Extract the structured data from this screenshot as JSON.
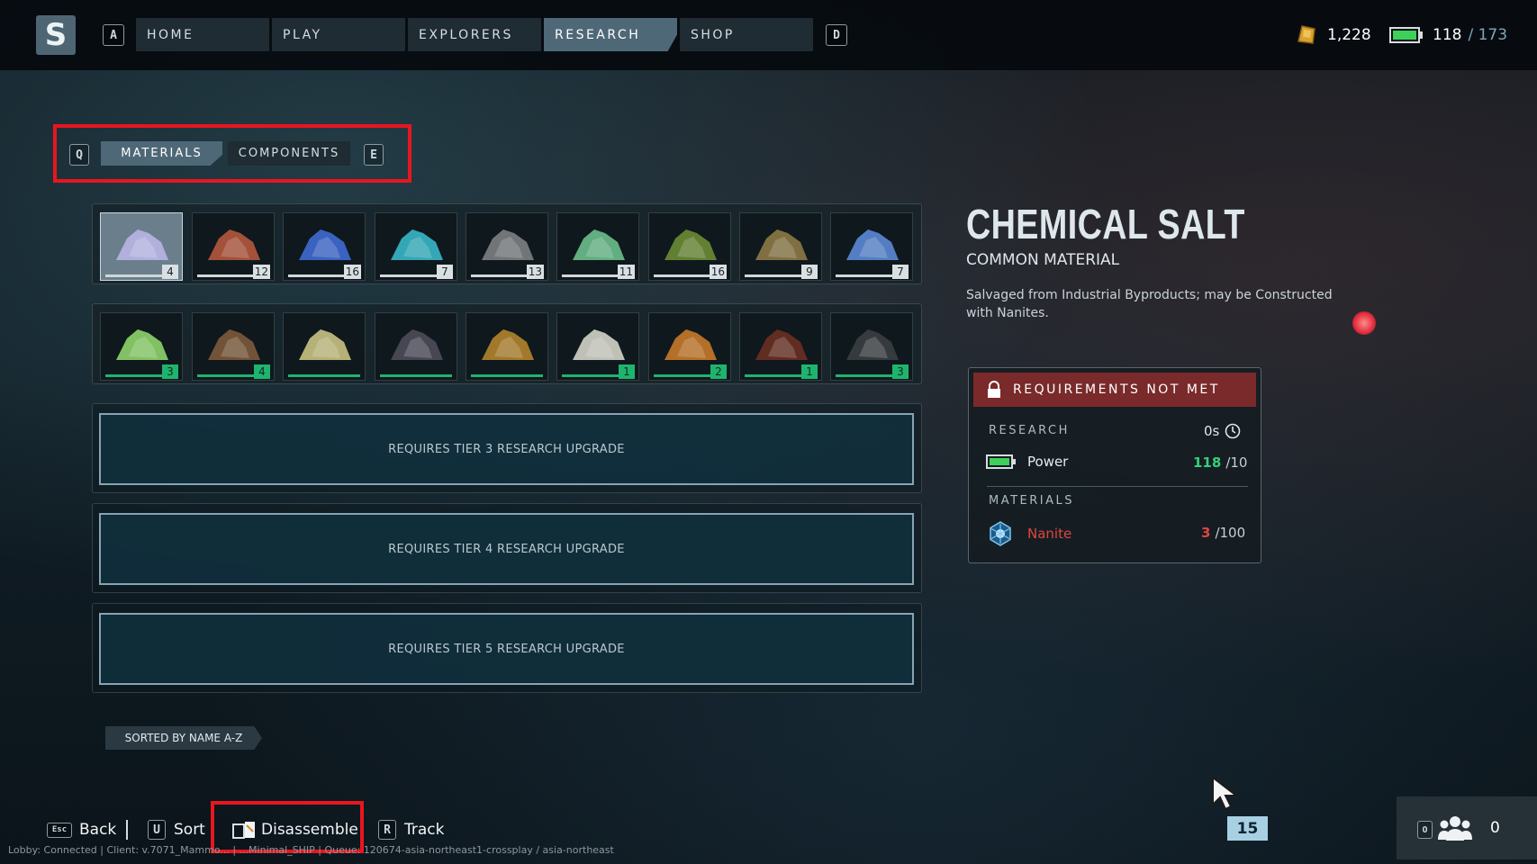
{
  "top_nav": {
    "logo_letter": "S",
    "left_key": "A",
    "right_key": "D",
    "tabs": [
      {
        "label": "HOME",
        "active": false
      },
      {
        "label": "PLAY",
        "active": false
      },
      {
        "label": "EXPLORERS",
        "active": false
      },
      {
        "label": "RESEARCH",
        "active": true
      },
      {
        "label": "SHOP",
        "active": false
      }
    ],
    "credits": "1,228",
    "power_current": "118",
    "power_max": "/ 173"
  },
  "sub_tabs": {
    "left_key": "Q",
    "right_key": "E",
    "materials": "MATERIALS",
    "components": "COMPONENTS",
    "active": "materials"
  },
  "inventory": {
    "row1": [
      {
        "name": "chemical-salt",
        "count": "4",
        "color": "#b9b6e6",
        "selected": true
      },
      {
        "name": "copper-ore",
        "count": "12",
        "color": "#b4583d"
      },
      {
        "name": "blue-crystal",
        "count": "16",
        "color": "#3f6ad3"
      },
      {
        "name": "cyan-crystal",
        "count": "7",
        "color": "#38b7c8"
      },
      {
        "name": "gray-rock",
        "count": "13",
        "color": "#7c7f83"
      },
      {
        "name": "green-plant",
        "count": "11",
        "color": "#6bbf8c"
      },
      {
        "name": "green-powder",
        "count": "16",
        "color": "#6b8c35"
      },
      {
        "name": "dry-plant",
        "count": "9",
        "color": "#8d7a46"
      },
      {
        "name": "blue-blocks",
        "count": "7",
        "color": "#5b8ad6"
      }
    ],
    "row2": [
      {
        "name": "lime-powder",
        "count": "3",
        "color": "#8fd46b"
      },
      {
        "name": "brown-roots",
        "count": "4",
        "color": "#7d5a3c"
      },
      {
        "name": "yellow-powder",
        "count": "",
        "color": "#c9c283"
      },
      {
        "name": "dark-rock",
        "count": "",
        "color": "#4d4d5a"
      },
      {
        "name": "orange-grains",
        "count": "",
        "color": "#b3842d"
      },
      {
        "name": "white-bones",
        "count": "1",
        "color": "#d3d3c8"
      },
      {
        "name": "molten-ore",
        "count": "2",
        "color": "#c77a2a"
      },
      {
        "name": "red-seed",
        "count": "1",
        "color": "#6a2f22"
      },
      {
        "name": "gray-ring",
        "count": "3",
        "color": "#3a3e42"
      }
    ],
    "locked_rows": [
      "REQUIRES TIER 3 RESEARCH UPGRADE",
      "REQUIRES TIER 4 RESEARCH UPGRADE",
      "REQUIRES TIER 5 RESEARCH UPGRADE"
    ],
    "sort_label": "SORTED BY NAME A-Z"
  },
  "detail": {
    "title": "CHEMICAL SALT",
    "subtitle": "COMMON MATERIAL",
    "description": "Salvaged from Industrial Byproducts; may be Constructed with Nanites.",
    "requirements_header": "REQUIREMENTS NOT MET",
    "research_label": "RESEARCH",
    "research_time": "0s",
    "power_label": "Power",
    "power_have": "118",
    "power_need": "/10",
    "materials_label": "MATERIALS",
    "nanite_label": "Nanite",
    "nanite_have": "3",
    "nanite_need": "/100"
  },
  "bottom_bar": {
    "back_key": "Esc",
    "back_label": "Back",
    "sort_key": "U",
    "sort_label": "Sort",
    "disassemble_label": "Disassemble",
    "track_key": "R",
    "track_label": "Track",
    "level": "15",
    "party_key": "O",
    "party_count": "0",
    "status_text": "Lobby: Connected | Client: v.7071_Mammo... | ...Minimal_SHIP | Queue: 120674-asia-northeast1-crossplay / asia-northeast"
  },
  "colors": {
    "accent_red": "#e8161f",
    "green": "#1fb46e",
    "warning_red": "#e0463c",
    "active_tab": "#4f6877"
  }
}
